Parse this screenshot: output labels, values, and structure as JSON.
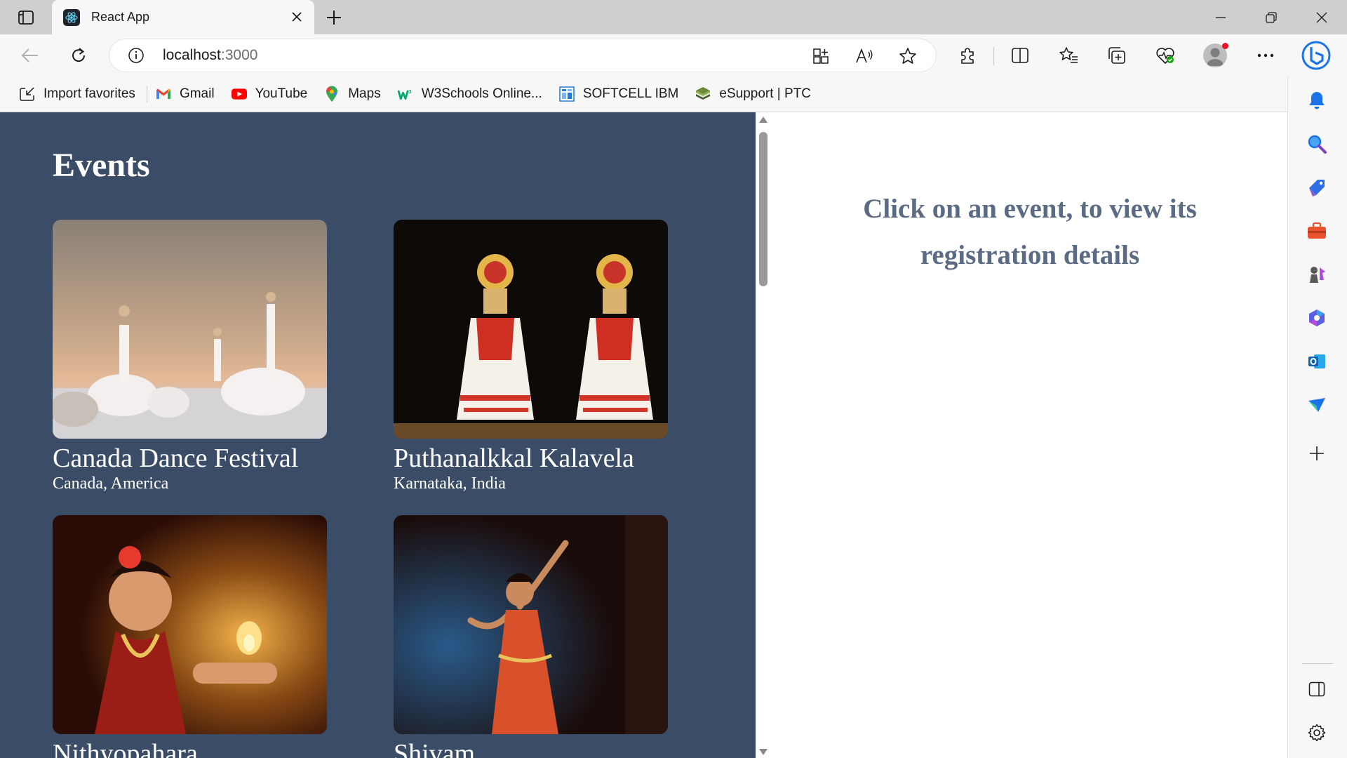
{
  "browser": {
    "tab": {
      "title": "React App"
    },
    "address": {
      "host": "localhost",
      "port": ":3000"
    },
    "favorites": [
      {
        "label": "Import favorites",
        "icon": "import-icon"
      },
      {
        "label": "Gmail",
        "icon": "gmail-icon"
      },
      {
        "label": "YouTube",
        "icon": "youtube-icon"
      },
      {
        "label": "Maps",
        "icon": "maps-icon"
      },
      {
        "label": "W3Schools Online...",
        "icon": "w3schools-icon"
      },
      {
        "label": "SOFTCELL IBM",
        "icon": "softcell-icon"
      },
      {
        "label": "eSupport | PTC",
        "icon": "ptc-icon"
      }
    ]
  },
  "page": {
    "title": "Events",
    "events": [
      {
        "name": "Canada Dance Festival",
        "location": "Canada, America"
      },
      {
        "name": "Puthanalkkal Kalavela",
        "location": "Karnataka, India"
      },
      {
        "name": "Nithyopahara",
        "location": ""
      },
      {
        "name": "Shivam",
        "location": ""
      }
    ],
    "details_message": "Click on an event, to view its registration details"
  },
  "colors": {
    "events_panel_bg": "#3b4d66",
    "details_text": "#5b6b83",
    "accent": "#0067c0"
  }
}
